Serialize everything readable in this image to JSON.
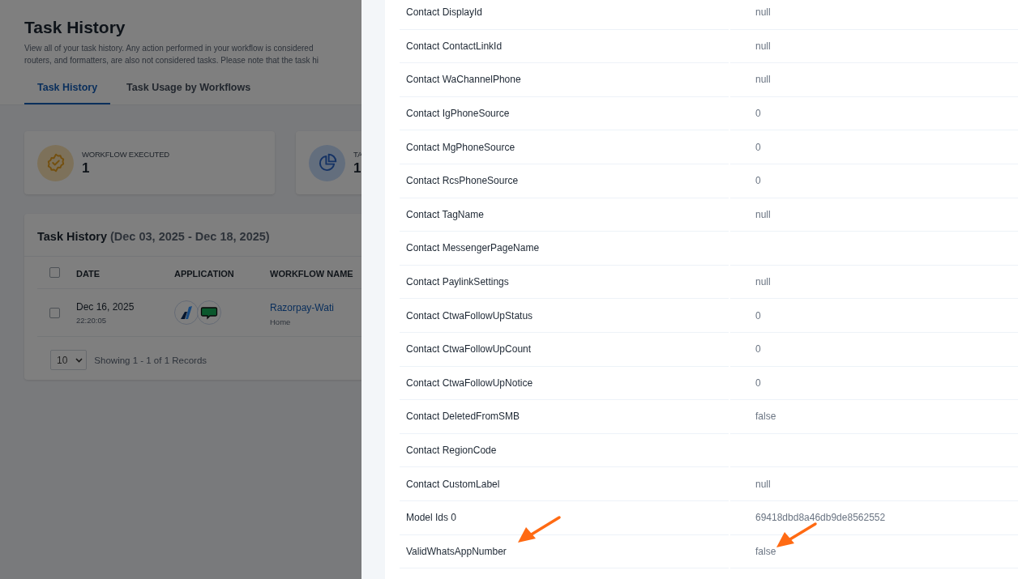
{
  "page": {
    "title": "Task History",
    "description": [
      "View all of your task history. Any action performed in your workflow is considered",
      "routers, and formatters, are also not considered tasks. Please note that the task hi"
    ],
    "tabs": [
      {
        "label": "Task History",
        "selected": true
      },
      {
        "label": "Task Usage by Workflows",
        "selected": false
      }
    ],
    "stats": [
      {
        "kind": "workflow",
        "label": "WORKFLOW EXECUTED",
        "value": "1"
      },
      {
        "kind": "tasks",
        "label": "TA",
        "value": "1"
      }
    ],
    "table": {
      "title": "Task History",
      "range": "(Dec 03, 2025 - Dec 18, 2025)",
      "columns": [
        "DATE",
        "APPLICATION",
        "WORKFLOW NAME"
      ],
      "header_checked": false,
      "rows": [
        {
          "checked": false,
          "date": "Dec 16, 2025",
          "time": "22:20:05",
          "apps": [
            {
              "kind": "logo"
            },
            {
              "kind": "chat"
            }
          ],
          "workflow": "Razorpay-Wati",
          "folder": "Home"
        }
      ],
      "page_size": "10",
      "summary": "Showing 1 - 1 of 1 Records"
    }
  },
  "drawer": {
    "fields": [
      {
        "label": "Contact DisplayId",
        "value": "null"
      },
      {
        "label": "Contact ContactLinkId",
        "value": "null"
      },
      {
        "label": "Contact WaChannelPhone",
        "value": "null"
      },
      {
        "label": "Contact IgPhoneSource",
        "value": "0"
      },
      {
        "label": "Contact MgPhoneSource",
        "value": "0"
      },
      {
        "label": "Contact RcsPhoneSource",
        "value": "0"
      },
      {
        "label": "Contact TagName",
        "value": "null"
      },
      {
        "label": "Contact MessengerPageName"
      },
      {
        "label": "Contact PaylinkSettings",
        "value": "null"
      },
      {
        "label": "Contact CtwaFollowUpStatus",
        "value": "0"
      },
      {
        "label": "Contact CtwaFollowUpCount",
        "value": "0"
      },
      {
        "label": "Contact CtwaFollowUpNotice",
        "value": "0"
      },
      {
        "label": "Contact DeletedFromSMB",
        "value": "false"
      },
      {
        "label": "Contact RegionCode"
      },
      {
        "label": "Contact CustomLabel",
        "value": "null"
      },
      {
        "label": "Model Ids 0",
        "value": "69418dbd8a46db9de8562552"
      },
      {
        "label": "ValidWhatsAppNumber",
        "value": "false"
      }
    ]
  }
}
